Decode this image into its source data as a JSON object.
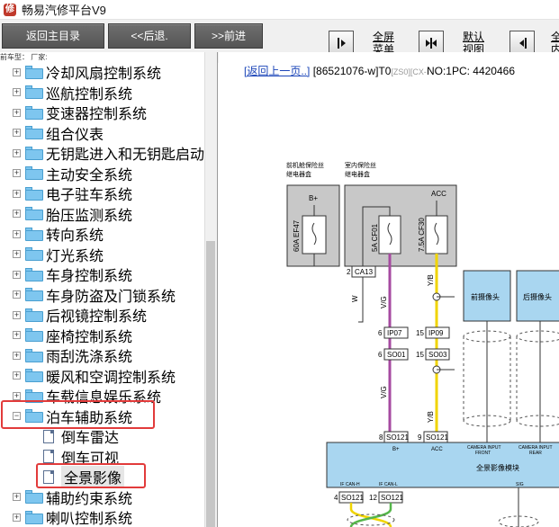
{
  "window": {
    "title": "畅易汽修平台V9"
  },
  "toolbar": {
    "back_main": "返回主目录",
    "back": "<<后退.",
    "forward": ">>前进",
    "fullscreen_label": "全屏\n菜单",
    "default_view_label": "默认\n视图",
    "partial_label": "全\n内"
  },
  "sidebar": {
    "filter_label": "前车型：     厂家:",
    "items": [
      {
        "label": "冷却风扇控制系统"
      },
      {
        "label": "巡航控制系统"
      },
      {
        "label": "变速器控制系统"
      },
      {
        "label": "组合仪表"
      },
      {
        "label": "无钥匙进入和无钥匙启动"
      },
      {
        "label": "主动安全系统"
      },
      {
        "label": "电子驻车系统"
      },
      {
        "label": "胎压监测系统"
      },
      {
        "label": "转向系统"
      },
      {
        "label": "灯光系统"
      },
      {
        "label": "车身控制系统"
      },
      {
        "label": "车身防盗及门锁系统"
      },
      {
        "label": "后视镜控制系统"
      },
      {
        "label": "座椅控制系统"
      },
      {
        "label": "雨刮洗涤系统"
      },
      {
        "label": "暖风和空调控制系统"
      },
      {
        "label": "车载信息娱乐系统"
      },
      {
        "label": "泊车辅助系统"
      }
    ],
    "children": [
      {
        "label": "倒车雷达"
      },
      {
        "label": "倒车可视"
      },
      {
        "label": "全景影像"
      }
    ],
    "after": [
      {
        "label": "辅助约束系统"
      },
      {
        "label": "喇叭控制系统"
      }
    ]
  },
  "content": {
    "back_link": "[返回上一页..]",
    "doc_code": "[86521076-w]T0",
    "gray_codes": "[ZS0][CX-",
    "doc_info": "NO:1PC: 4420466"
  },
  "diagram": {
    "box1_title": "前机舱保险丝\n继电器盒",
    "box2_title": "室内保险丝\n继电器盒",
    "b_plus": "B+",
    "acc": "ACC",
    "fuse1": "60A EF47",
    "fuse2": "5A CF01",
    "fuse3": "7.5A CF30",
    "connector_ca13": "CA13",
    "pin_2": "2",
    "wire_w": "W",
    "wire_vg1": "V/G",
    "wire_yb1": "Y/B",
    "wire_vg2": "V/G",
    "wire_yb2": "Y/B",
    "ip07": "IP07",
    "ip09": "IP09",
    "so01": "SO01",
    "so03": "SO03",
    "pin_6a": "6",
    "pin_15a": "15",
    "pin_6b": "6",
    "pin_15b": "15",
    "pin_8": "8",
    "pin_9": "9",
    "so121_a": "SO121",
    "so121_b": "SO121",
    "so121_c": "SO121",
    "so121_d": "SO121",
    "pin_4": "4",
    "pin_12": "12",
    "front_camera": "前摄像头",
    "rear_camera": "后摄像头",
    "module_name": "全景影像模块",
    "module_bplus": "B+",
    "module_acc": "ACC",
    "camera_front_label": "CAMERA INPUT\nFRONT",
    "camera_rear_label": "CAMERA INPUT\nREAR",
    "can_h": "IF CAN-H",
    "can_l": "IF CAN-L",
    "sig": "SIG",
    "colors": {
      "violet": "#a64aa0",
      "yellow": "#f0d400",
      "line": "#333333",
      "box": "#c8c8c8",
      "module": "#a9d6f0"
    }
  }
}
